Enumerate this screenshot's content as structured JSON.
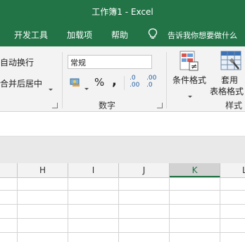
{
  "window": {
    "title": "工作簿1  -  Excel"
  },
  "tabs": [
    {
      "label": "开发工具"
    },
    {
      "label": "加载项"
    },
    {
      "label": "帮助"
    }
  ],
  "tell_me": {
    "text": "告诉我你想要做什么"
  },
  "ribbon": {
    "alignment": {
      "wrap_text": "自动换行",
      "merge_center": "合并后居中"
    },
    "number": {
      "format_value": "常规",
      "percent_symbol": "%",
      "comma_symbol": ",",
      "inc_decimal_top": ".0",
      "inc_decimal_bottom": ".00",
      "dec_decimal_top": ".00",
      "dec_decimal_bottom": ".0",
      "group_label": "数字"
    },
    "styles": {
      "conditional_format": "条件格式",
      "format_as_table_line1": "套用",
      "format_as_table_line2": "表格格式",
      "group_label": "样式"
    }
  },
  "columns": [
    {
      "label": "H",
      "selected": false
    },
    {
      "label": "I",
      "selected": false
    },
    {
      "label": "J",
      "selected": false
    },
    {
      "label": "K",
      "selected": true
    },
    {
      "label": "L",
      "selected": false
    }
  ],
  "colors": {
    "accent": "#227447",
    "ribbon_bg": "#f3f3f3",
    "selected_col": "#217346"
  }
}
